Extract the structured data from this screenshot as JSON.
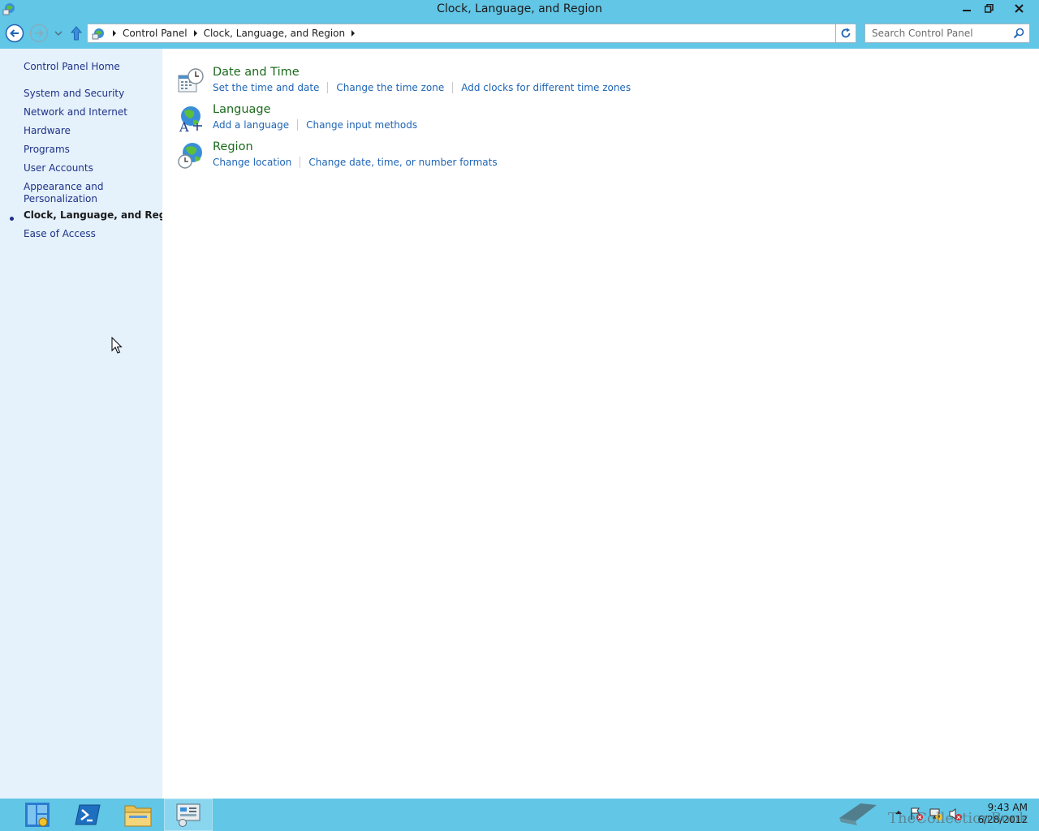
{
  "window": {
    "title": "Clock, Language, and Region"
  },
  "address_bar": {
    "crumbs": [
      "Control Panel",
      "Clock, Language, and Region"
    ]
  },
  "search": {
    "placeholder": "Search Control Panel"
  },
  "sidebar": {
    "items": [
      {
        "label": "Control Panel Home"
      },
      {
        "label": "System and Security"
      },
      {
        "label": "Network and Internet"
      },
      {
        "label": "Hardware"
      },
      {
        "label": "Programs"
      },
      {
        "label": "User Accounts"
      },
      {
        "label": "Appearance and Personalization"
      },
      {
        "label": "Clock, Language, and Region",
        "active": true
      },
      {
        "label": "Ease of Access"
      }
    ]
  },
  "categories": [
    {
      "title": "Date and Time",
      "icon": "calendar-clock-icon",
      "links": [
        "Set the time and date",
        "Change the time zone",
        "Add clocks for different time zones"
      ]
    },
    {
      "title": "Language",
      "icon": "language-globe-icon",
      "links": [
        "Add a language",
        "Change input methods"
      ]
    },
    {
      "title": "Region",
      "icon": "region-globe-icon",
      "links": [
        "Change location",
        "Change date, time, or number formats"
      ]
    }
  ],
  "taskbar": {
    "items": [
      "server-manager-icon",
      "powershell-icon",
      "file-explorer-icon",
      "control-panel-icon"
    ],
    "clock": {
      "time": "9:43 AM",
      "date": "6/28/2012"
    }
  },
  "watermark": {
    "text": "TheCollectionBook"
  },
  "colors": {
    "accent": "#62c6e6",
    "sidebar_bg": "#e5f1fb",
    "link": "#1e64b4",
    "category_title": "#1c6a1c"
  }
}
